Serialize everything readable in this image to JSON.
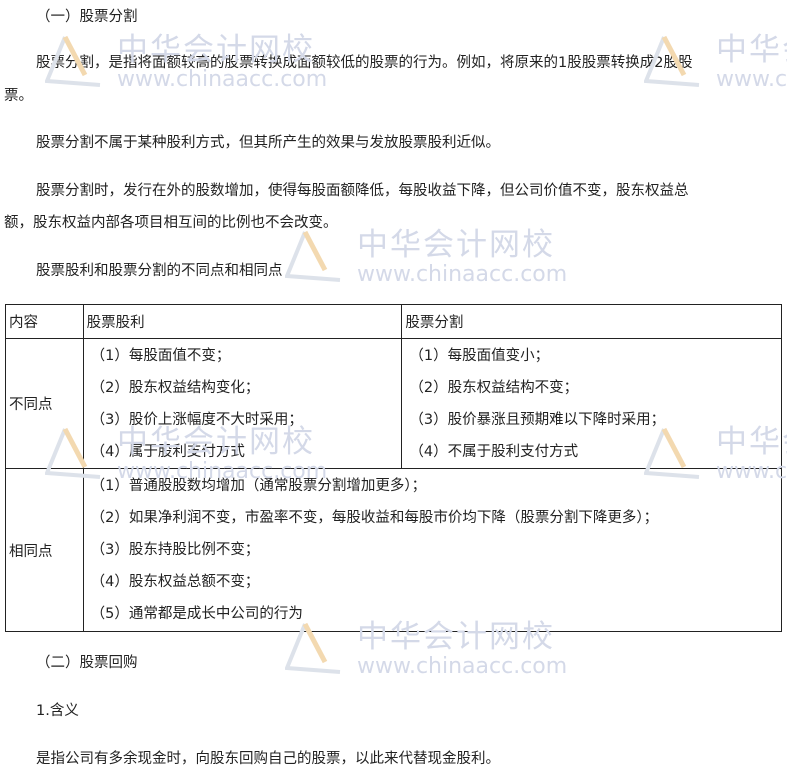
{
  "section1_title": "（一）股票分割",
  "para1_line1": "股票分割，是指将面额较高的股票转换成面额较低的股票的行为。例如，将原来的1股股票转换成2股股",
  "para1_line2": "票。",
  "para2": "股票分割不属于某种股利方式，但其所产生的效果与发放股票股利近似。",
  "para3_line1": "股票分割时，发行在外的股数增加，使得每股面额降低，每股收益下降，但公司价值不变，股东权益总",
  "para3_line2": "额，股东权益内部各项目相互间的比例也不会改变。",
  "para4": "股票股利和股票分割的不同点和相同点",
  "table": {
    "headers": [
      "内容",
      "股票股利",
      "股票分割"
    ],
    "diff_label": "不同点",
    "diff_dividend": [
      "（1）每股面值不变；",
      "（2）股东权益结构变化；",
      "（3）股价上涨幅度不大时采用；",
      "（4）属于股利支付方式"
    ],
    "diff_split": [
      "（1）每股面值变小；",
      "（2）股东权益结构不变；",
      "（3）股价暴涨且预期难以下降时采用；",
      "（4）不属于股利支付方式"
    ],
    "same_label": "相同点",
    "same_items": [
      "（1）普通股股数均增加（通常股票分割增加更多）；",
      "（2）如果净利润不变，市盈率不变，每股收益和每股市价均下降（股票分割下降更多）；",
      "（3）股东持股比例不变；",
      "（4）股东权益总额不变；",
      "（5）通常都是成长中公司的行为"
    ]
  },
  "section2_title": "（二）股票回购",
  "sub1_title": "1.含义",
  "sub1_text": "是指公司有多余现金时，向股东回购自己的股票，以此来代替现金股利。",
  "watermark": {
    "cn": "中华会计网校",
    "url": "www.chinaacc.com"
  }
}
